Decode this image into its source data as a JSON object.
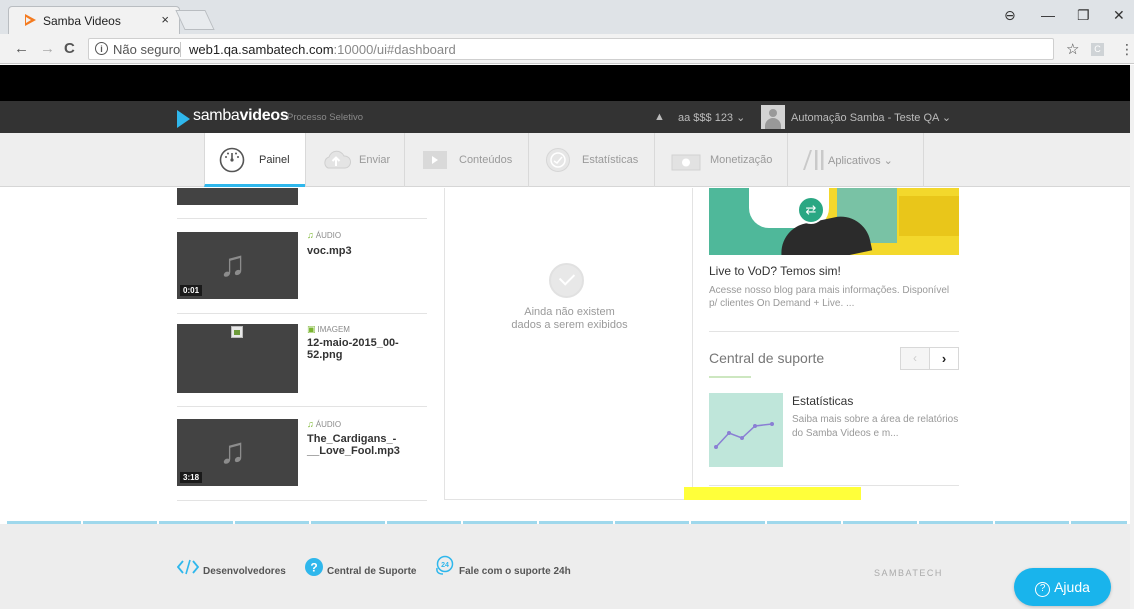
{
  "browser": {
    "tab_title": "Samba Videos",
    "tab_close": "×",
    "not_secure": "Não seguro",
    "url_host": "web1.qa.sambatech.com",
    "url_path": ":10000/ui#dashboard",
    "star": "☆",
    "ext_label": "C",
    "menu": "⋮",
    "back": "←",
    "forward": "→",
    "reload": "C",
    "win_account": "⊖",
    "win_min": "—",
    "win_max": "❐",
    "win_close": "✕"
  },
  "header": {
    "logo_light": "samba",
    "logo_bold": "videos",
    "subtitle": "Processo Seletivo",
    "bell": "🔔",
    "account": "aa $$$ 123 ⌄",
    "user": "Automação Samba - Teste QA ⌄"
  },
  "nav": {
    "items": [
      {
        "label": "Painel",
        "icon": "dashboard-icon"
      },
      {
        "label": "Enviar",
        "icon": "upload-cloud-icon"
      },
      {
        "label": "Conteúdos",
        "icon": "play-folder-icon"
      },
      {
        "label": "Estatísticas",
        "icon": "stats-icon"
      },
      {
        "label": "Monetização",
        "icon": "money-icon"
      },
      {
        "label": "Aplicativos ⌄",
        "icon": "apps-icon"
      }
    ]
  },
  "media": {
    "items": [
      {
        "type": "ÁUDIO",
        "name": "voc.mp3",
        "duration": "0:01",
        "kind": "audio"
      },
      {
        "type": "IMAGEM",
        "name": "12-maio-2015_00-52.png",
        "duration": "",
        "kind": "image"
      },
      {
        "type": "ÁUDIO",
        "name": "The_Cardigans_-__Love_Fool.mp3",
        "duration": "3:18",
        "kind": "audio"
      }
    ]
  },
  "empty": {
    "line1": "Ainda não existem",
    "line2": "dados a serem exibidos"
  },
  "blog": {
    "title": "Live to VoD? Temos sim!",
    "desc": "Acesse nosso blog para mais informações. Disponível p/ clientes On Demand + Live.  ..."
  },
  "support": {
    "title": "Central de suporte",
    "prev": "‹",
    "next": "›",
    "card_title": "Estatísticas",
    "card_desc": "Saiba mais sobre a área de relatórios do Samba Videos e m..."
  },
  "footer": {
    "dev": "Desenvolvedores",
    "central": "Central de Suporte",
    "fale": "Fale com o suporte 24h",
    "brand": "SAMBATECH",
    "ajuda": "Ajuda"
  },
  "colors": {
    "accent": "#2fb7ec",
    "header_bg": "#333333",
    "highlight": "#ffff3a",
    "help_button": "#19b4ec"
  }
}
